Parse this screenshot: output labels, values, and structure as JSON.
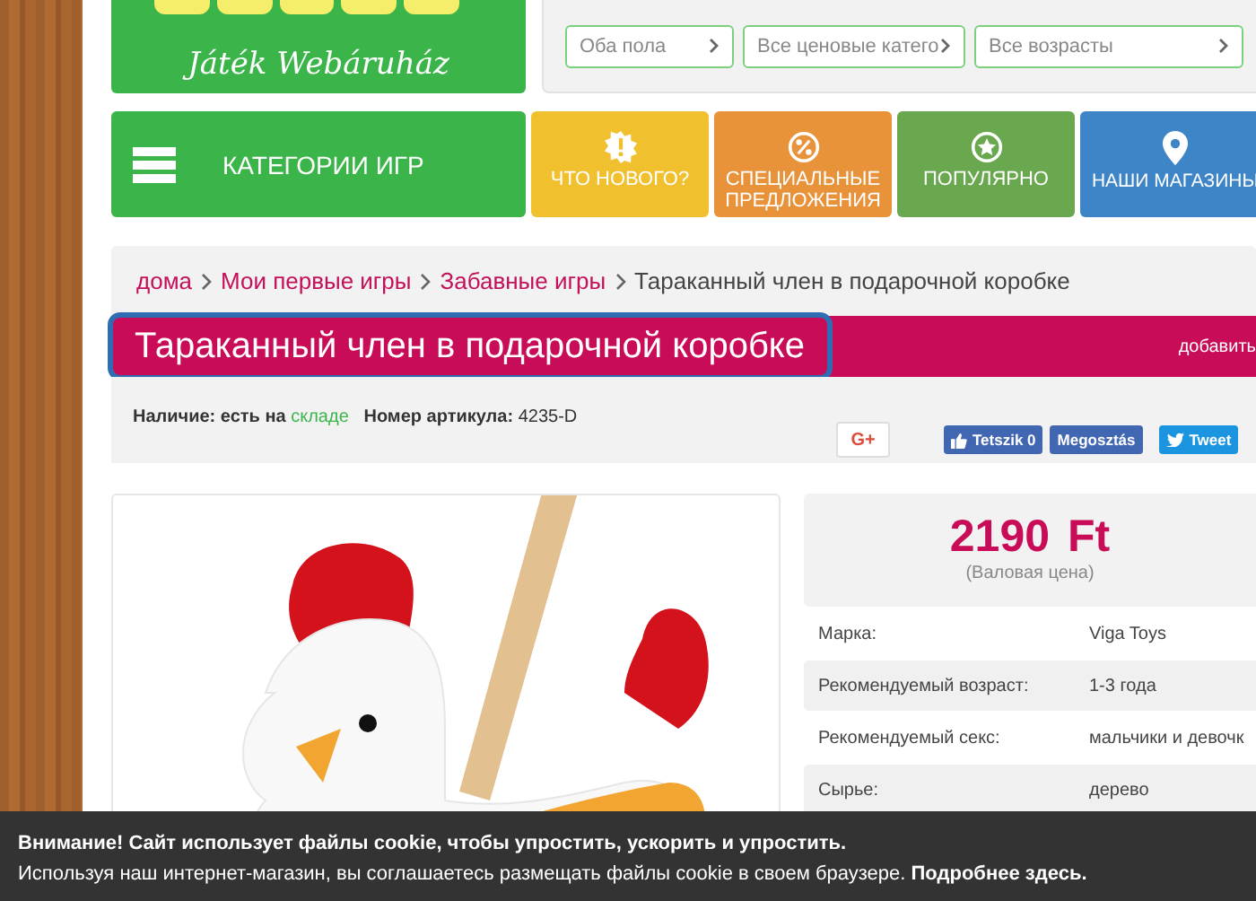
{
  "logo": {
    "tagline": "Játék Webáruház"
  },
  "filters": [
    {
      "value": "Оба пола"
    },
    {
      "value": "Все ценовые катего"
    },
    {
      "value": "Все возрасты"
    }
  ],
  "nav": [
    {
      "kind": "menu",
      "label": "КАТЕГОРИИ ИГР",
      "color": "#3bb54a"
    },
    {
      "kind": "new",
      "label": "ЧТО НОВОГО?",
      "color": "#f0c02f"
    },
    {
      "kind": "sale",
      "label": "СПЕЦИАЛЬНЫЕ ПРЕДЛОЖЕНИЯ",
      "color": "#e8923a"
    },
    {
      "kind": "popular",
      "label": "ПОПУЛЯРНО",
      "color": "#6aa84f"
    },
    {
      "kind": "stores",
      "label": "НАШИ МАГАЗИНЫ",
      "color": "#3d85c6"
    }
  ],
  "breadcrumb": [
    {
      "text": "дома",
      "current": false
    },
    {
      "text": "Мои первые игры",
      "current": false
    },
    {
      "text": "Забавные игры",
      "current": false
    },
    {
      "text": "Тараканный член в подарочной коробке",
      "current": true
    }
  ],
  "product": {
    "title": "Тараканный член в подарочной коробке",
    "focused": true,
    "add_label": "добавить",
    "availability_label": "Наличие: есть на",
    "availability_link": "складе",
    "article_label": "Номер артикула:",
    "article": "4235-D"
  },
  "social": [
    {
      "kind": "gplus",
      "label": "G+"
    },
    {
      "kind": "like",
      "label": "Tetszik 0"
    },
    {
      "kind": "share",
      "label": "Megosztás"
    },
    {
      "kind": "tweet",
      "label": "Tweet"
    }
  ],
  "price": {
    "amount": "2190 Ft",
    "note": "(Валовая цена)"
  },
  "specs": [
    {
      "label": "Марка:",
      "value": "Viga Toys"
    },
    {
      "label": "Рекомендуемый возраст:",
      "value": "1-3 года"
    },
    {
      "label": "Рекомендуемый секс:",
      "value": "мальчики и девочк"
    },
    {
      "label": "Сырье:",
      "value": "дерево"
    }
  ],
  "cookie": {
    "title": "Внимание! Сайт использует файлы cookie, чтобы упростить, ускорить и упростить.",
    "text": "Используя наш интернет-магазин, вы соглашаетесь размещать файлы cookie в своем браузере. **Подробнее здесь.**"
  }
}
